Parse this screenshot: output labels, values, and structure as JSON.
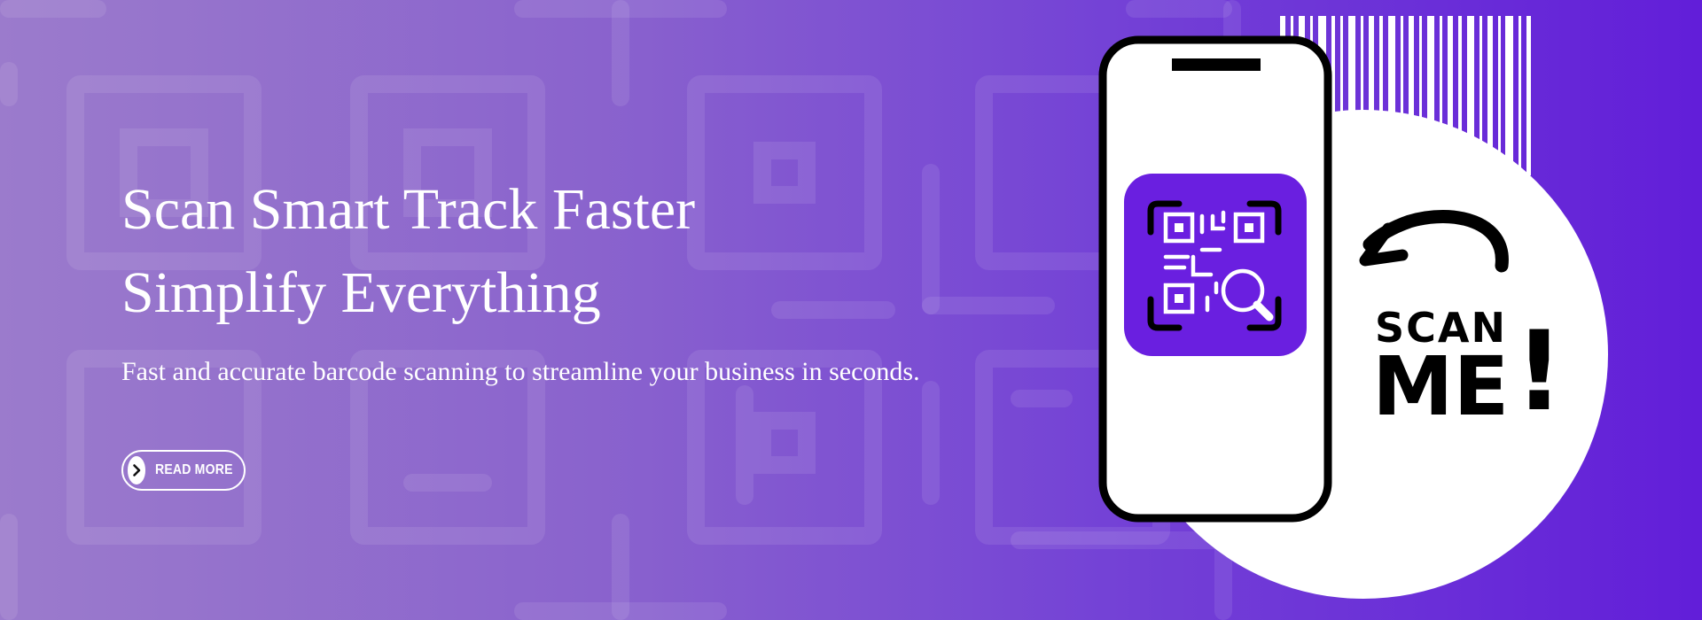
{
  "hero": {
    "headline_line1": "Scan Smart Track Faster",
    "headline_line2": "Simplify Everything",
    "subtext": "Fast and accurate barcode scanning to streamline your business in seconds.",
    "cta_label": "READ MORE"
  },
  "illustration": {
    "scan_text": "SCAN",
    "me_text": "ME",
    "exclaim": "!"
  },
  "colors": {
    "gradient_start": "#9b7bcc",
    "gradient_end": "#621ed9",
    "accent_purple": "#6a1fe0",
    "outline": "#000000",
    "white": "#ffffff"
  },
  "icons": [
    "chevron-right-icon",
    "qr-search-icon",
    "curved-arrow-icon",
    "barcode-icon",
    "phone-icon"
  ]
}
